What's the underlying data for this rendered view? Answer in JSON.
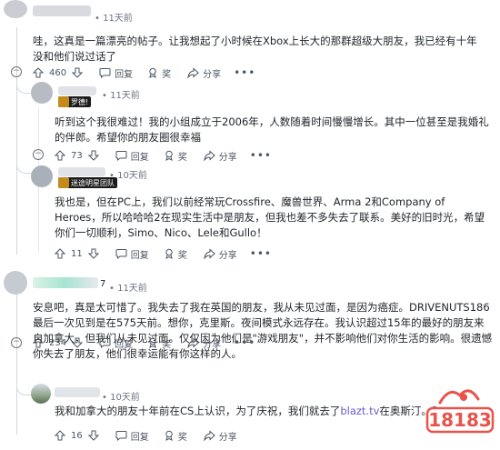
{
  "comments": [
    {
      "time": "• 11天前",
      "text": "哇，这真是一篇漂亮的帖子。让我想起了小时候在Xbox上长大的那群超级大朋友，我已经有十年没和他们说过话了",
      "votes": "460",
      "award": "",
      "reply": "回复",
      "share": "分享"
    },
    {
      "flair": "罗德!",
      "time": "• 11天前",
      "text": "听到这个我很难过！我的小组成立于2006年，人数随着时间慢慢增长。其中一位甚至是我婚礼的伴郎。希望你的朋友圈很幸福",
      "votes": "73",
      "reply": "回复",
      "share": "分享"
    },
    {
      "flair": "迷途明星团队",
      "time": "• 10天前",
      "text": "我也是，但在PC上，我们以前经常玩Crossfire、魔兽世界、Arma 2和Company of Heroes，所以哈哈哈2在现实生活中是朋友，但我也差不多失去了联系。美好的旧时光，希望你们一切顺利，Simo、Nico、Lele和Gullo！",
      "votes": "11",
      "reply": "回复",
      "share": "分享"
    },
    {
      "user_suffix": "7",
      "time": "• 11天前",
      "text": "安息吧，真是太可惜了。我失去了我在英国的朋友，我从未见过面，是因为癌症。DRIVENUTS186最后一次见到是在575天前。想你，克里斯。夜间模式永远存在。我认识超过15年的最好的朋友来自加拿大，但我们从未见过面。仅仅因为他们是\"游戏朋友\"，并不影响他们对你生活的影响。很遗憾你失去了朋友，他们很幸运能有你这样的人。",
      "votes": "234",
      "reply": "回复",
      "share": "分享"
    },
    {
      "time": "• 10天前",
      "text_before": "我和加拿大的朋友十年前在CS上认识，为了庆祝，我们就去了",
      "link": "blazt.tv",
      "text_after": "在奥斯汀。真是",
      "votes": "16",
      "reply": "回复",
      "share": "分享"
    }
  ],
  "expand_symbol": "−",
  "watermark_text": "18183",
  "colors": {
    "accent": "#6a5acd",
    "flair_bg": "#1c1c1c",
    "flair_badge": "#c48a1d",
    "watermark": "#e8534a"
  }
}
